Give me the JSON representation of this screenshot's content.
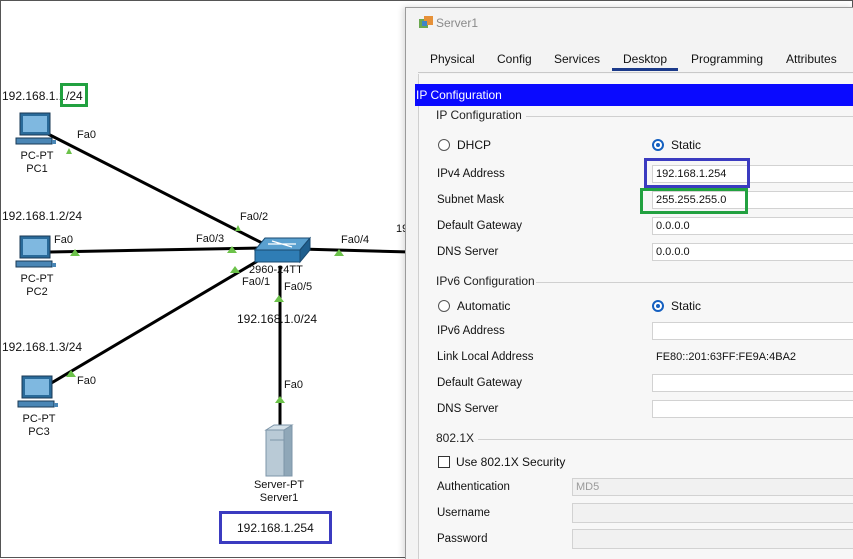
{
  "topology": {
    "pcs": [
      {
        "type": "PC-PT",
        "name": "PC1",
        "ip_prefix": "192.168.1.1",
        "ip_suffix": "/24",
        "port": "Fa0"
      },
      {
        "type": "PC-PT",
        "name": "PC2",
        "ip": "192.168.1.2/24",
        "port": "Fa0"
      },
      {
        "type": "PC-PT",
        "name": "PC3",
        "ip": "192.168.1.3/24",
        "port": "Fa0"
      }
    ],
    "switch": {
      "model": "2960-24TT",
      "ports": {
        "fa02": "Fa0/2",
        "fa03": "Fa0/3",
        "fa01": "Fa0/1",
        "fa05": "Fa0/5",
        "fa04": "Fa0/4"
      }
    },
    "network_label": "192.168.1.0/24",
    "right_partial_label": "19",
    "server": {
      "type": "Server-PT",
      "name": "Server1",
      "port": "Fa0",
      "ip": "192.168.1.254"
    }
  },
  "window": {
    "title": "Server1",
    "tabs": [
      "Physical",
      "Config",
      "Services",
      "Desktop",
      "Programming",
      "Attributes"
    ],
    "active_tab": "Desktop",
    "header": "IP Configuration",
    "ipv4": {
      "group_title": "IP Configuration",
      "dhcp_label": "DHCP",
      "static_label": "Static",
      "ipv4_label": "IPv4 Address",
      "ipv4_value": "192.168.1.254",
      "mask_label": "Subnet Mask",
      "mask_value": "255.255.255.0",
      "gateway_label": "Default Gateway",
      "gateway_value": "0.0.0.0",
      "dns_label": "DNS Server",
      "dns_value": "0.0.0.0"
    },
    "ipv6": {
      "group_title": "IPv6 Configuration",
      "auto_label": "Automatic",
      "static_label": "Static",
      "addr_label": "IPv6 Address",
      "addr_value": "",
      "lla_label": "Link Local Address",
      "lla_value": "FE80::201:63FF:FE9A:4BA2",
      "gateway_label": "Default Gateway",
      "gateway_value": "",
      "dns_label": "DNS Server",
      "dns_value": ""
    },
    "dot1x": {
      "group_title": "802.1X",
      "use_label": "Use 802.1X Security",
      "auth_label": "Authentication",
      "auth_value": "MD5",
      "user_label": "Username",
      "user_value": "",
      "pass_label": "Password",
      "pass_value": ""
    }
  },
  "colors": {
    "highlight_green": "#22a140",
    "highlight_blue": "#3b3bc0",
    "header_blue": "#0a0aff",
    "link_triangle": "#6cc24a"
  }
}
